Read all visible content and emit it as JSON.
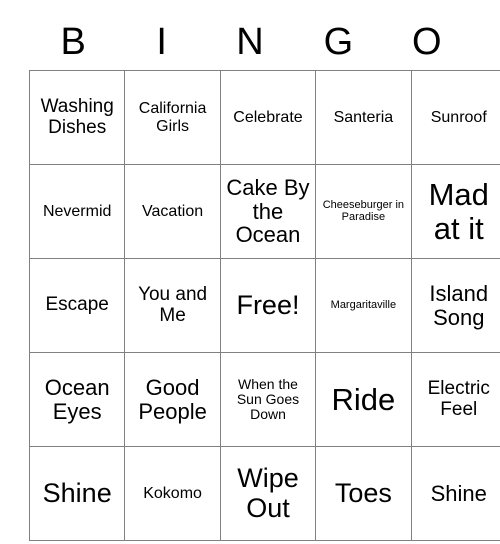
{
  "card": {
    "header_letters": [
      "B",
      "I",
      "N",
      "G",
      "O"
    ],
    "rows": [
      [
        {
          "text": "Washing Dishes",
          "size": "lg"
        },
        {
          "text": "California Girls",
          "size": "md"
        },
        {
          "text": "Celebrate",
          "size": "md"
        },
        {
          "text": "Santeria",
          "size": "md"
        },
        {
          "text": "Sunroof",
          "size": "md"
        }
      ],
      [
        {
          "text": "Nevermid",
          "size": "md"
        },
        {
          "text": "Vacation",
          "size": "md"
        },
        {
          "text": "Cake By the Ocean",
          "size": "xl"
        },
        {
          "text": "Cheeseburger in Paradise",
          "size": "xs"
        },
        {
          "text": "Mad at it",
          "size": "huge"
        }
      ],
      [
        {
          "text": "Escape",
          "size": "lg"
        },
        {
          "text": "You and Me",
          "size": "lg"
        },
        {
          "text": "Free!",
          "size": "xxl"
        },
        {
          "text": "Margaritaville",
          "size": "xs"
        },
        {
          "text": "Island Song",
          "size": "xl"
        }
      ],
      [
        {
          "text": "Ocean Eyes",
          "size": "xl"
        },
        {
          "text": "Good People",
          "size": "xl"
        },
        {
          "text": "When the Sun Goes Down",
          "size": "sm"
        },
        {
          "text": "Ride",
          "size": "huge"
        },
        {
          "text": "Electric Feel",
          "size": "lg"
        }
      ],
      [
        {
          "text": "Shine",
          "size": "xxl"
        },
        {
          "text": "Kokomo",
          "size": "md"
        },
        {
          "text": "Wipe Out",
          "size": "xxl"
        },
        {
          "text": "Toes",
          "size": "xxl"
        },
        {
          "text": "Shine",
          "size": "xl"
        }
      ]
    ]
  },
  "colors": {
    "background": "#ffffff",
    "text": "#000000",
    "grid_border": "#808080"
  }
}
